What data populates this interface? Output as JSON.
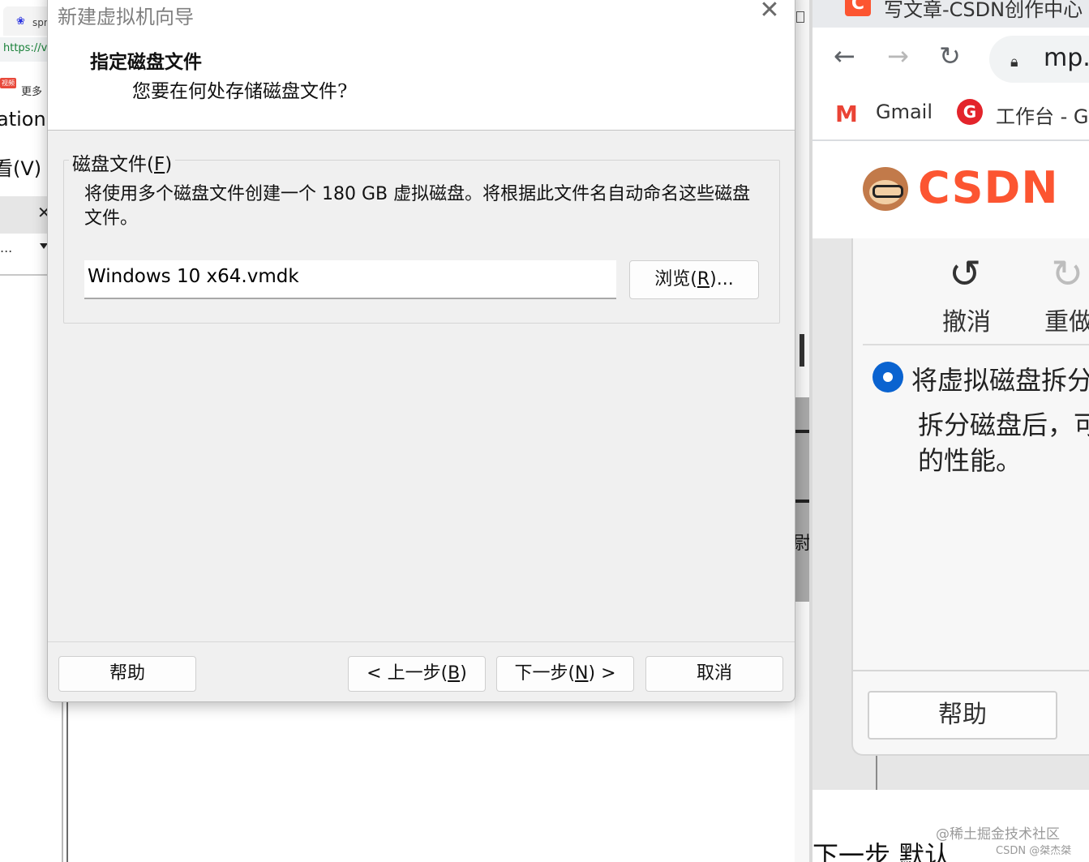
{
  "dialog": {
    "title": "新建虚拟机向导",
    "close_glyph": "✕",
    "step_title": "指定磁盘文件",
    "step_subtitle": "您要在何处存储磁盘文件?",
    "group_label_prefix": "磁盘文件(",
    "group_label_key": "F",
    "group_label_suffix": ")",
    "description": "将使用多个磁盘文件创建一个 180 GB 虚拟磁盘。将根据此文件名自动命名这些磁盘文件。",
    "file_value": "Windows 10 x64.vmdk",
    "browse": {
      "prefix": "浏览(",
      "key": "R",
      "suffix": ")..."
    },
    "buttons": {
      "help": "帮助",
      "back": {
        "prefix": "< 上一步(",
        "key": "B",
        "suffix": ")"
      },
      "next": {
        "prefix": "下一步(",
        "key": "N",
        "suffix": ") >"
      },
      "cancel": "取消"
    }
  },
  "background_left": {
    "tab_text": "spr",
    "url_text": "https://v",
    "badge": "视频",
    "more": "更多",
    "text1": "ation",
    "text2": "看(V)",
    "dots": "..."
  },
  "gap": {
    "glyph": "尉"
  },
  "csdn_window": {
    "favicon": "C",
    "tab_title": "写文章-CSDN创作中心",
    "url": "mp.c",
    "bookmarks": {
      "gmail": "Gmail",
      "g_icon": "G",
      "workbench": "工作台 - G"
    },
    "logo_text": "CSDN",
    "toolbar": {
      "undo": "撤消",
      "redo": "重做"
    },
    "radio_label": "将虚拟磁盘拆分",
    "radio_desc_line1": "拆分磁盘后，可",
    "radio_desc_line2": "的性能。",
    "help_button": "帮助",
    "bottom_text": "下一步  默认",
    "watermark_line1": "@稀土掘金技术社区",
    "watermark_line2": "CSDN @桀杰桀"
  },
  "colors": {
    "csdn_orange": "#fc5531",
    "radio_blue": "#0a63d0",
    "dialog_bg": "#f0f0f0"
  }
}
